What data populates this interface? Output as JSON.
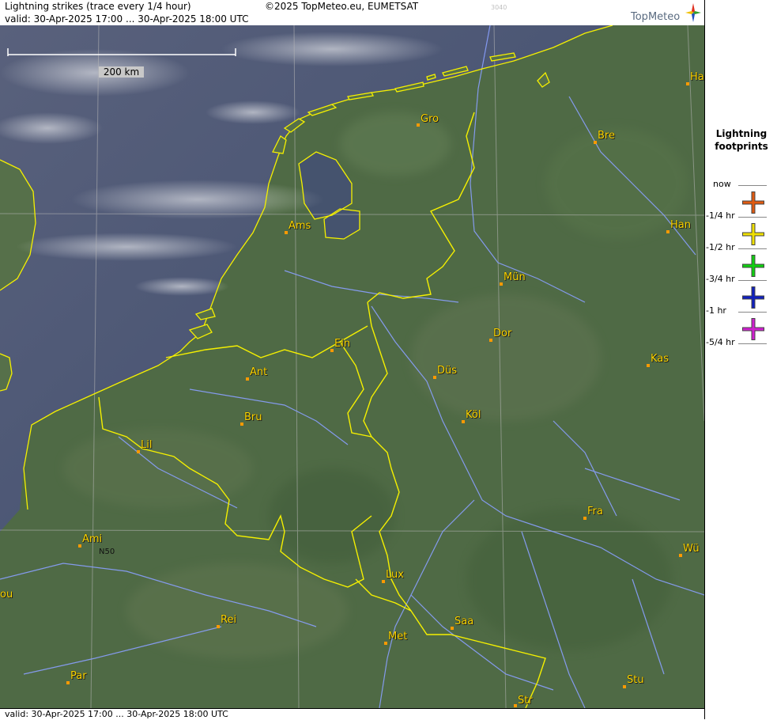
{
  "header": {
    "title": "Lightning strikes (trace every 1/4 hour)",
    "copyright": "©2025 TopMeteo.eu, EUMETSAT",
    "code": "3040",
    "valid": "valid:  30-Apr-2025 17:00 ... 30-Apr-2025 18:00 UTC",
    "brand": "TopMeteo"
  },
  "footer": {
    "valid": "valid:  30-Apr-2025 17:00 ... 30-Apr-2025 18:00 UTC"
  },
  "scale": {
    "label": "200 km"
  },
  "grid_label": "N50",
  "legend": {
    "title_line1": "Lightning",
    "title_line2": "footprints",
    "times": [
      "now",
      "-1/4 hr",
      "-1/2 hr",
      "-3/4 hr",
      "-1 hr",
      "-5/4 hr"
    ],
    "colors": [
      "#e05a10",
      "#f0e000",
      "#10d010",
      "#1020c0",
      "#d020d0"
    ],
    "icon": "cross-marker-icon"
  },
  "cities": [
    {
      "name": "Gro"
    },
    {
      "name": "Bre"
    },
    {
      "name": "Ha"
    },
    {
      "name": "Ams"
    },
    {
      "name": "Han"
    },
    {
      "name": "Mün"
    },
    {
      "name": "Ein"
    },
    {
      "name": "Dor"
    },
    {
      "name": "Ant"
    },
    {
      "name": "Düs"
    },
    {
      "name": "Kas"
    },
    {
      "name": "Bru"
    },
    {
      "name": "Köl"
    },
    {
      "name": "Lil"
    },
    {
      "name": "Fra"
    },
    {
      "name": "Ami"
    },
    {
      "name": "Wü"
    },
    {
      "name": "Lux"
    },
    {
      "name": "ou"
    },
    {
      "name": "Rei"
    },
    {
      "name": "Saa"
    },
    {
      "name": "Met"
    },
    {
      "name": "Par"
    },
    {
      "name": "Stu"
    },
    {
      "name": "Str"
    }
  ],
  "colors": {
    "border": "#f5f000",
    "river": "#8aa0ff",
    "city": "#ffd800",
    "sea": "#3e4a66",
    "land": "#4f6a45"
  }
}
